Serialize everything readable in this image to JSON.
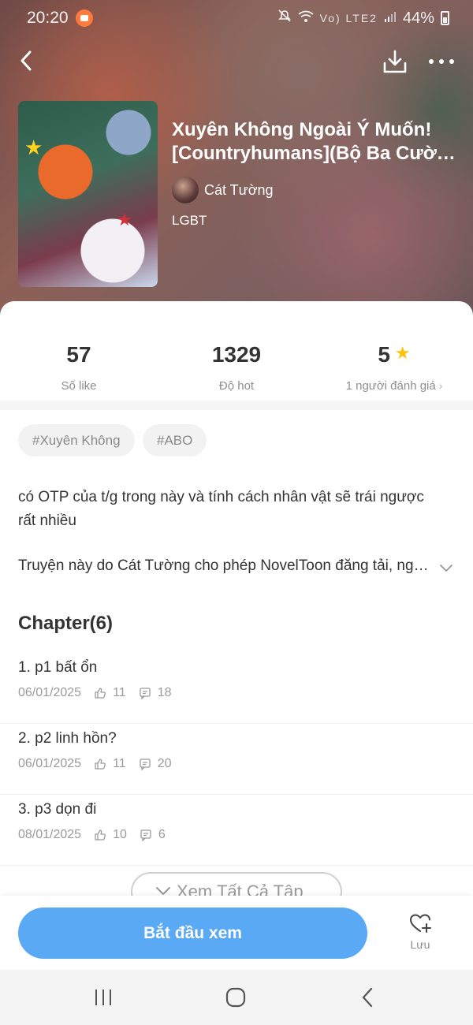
{
  "status_bar": {
    "time": "20:20",
    "network_label": "Vo) LTE2",
    "battery": "44%"
  },
  "book": {
    "title_line1": "Xuyên Không Ngoài Ý Muốn!",
    "title_line2": "[Countryhumans](Bộ Ba Cường Quốc)",
    "author": "Cát Tường",
    "genre": "LGBT"
  },
  "stats": {
    "likes": {
      "value": "57",
      "label": "Số like"
    },
    "hot": {
      "value": "1329",
      "label": "Độ hot"
    },
    "rating": {
      "value": "5",
      "label": "1 người đánh giá"
    }
  },
  "tags": [
    "#Xuyên Không",
    "#ABO"
  ],
  "description": "có OTP của t/g trong này và tính cách nhân vật sẽ trái ngược rất nhiều",
  "copyright": "Truyện này do Cát Tường cho phép NovelToon đăng tải, nghiêm cấm sao chép",
  "chapters": {
    "heading": "Chapter(6)",
    "items": [
      {
        "title": "1. p1 bất ổn",
        "date": "06/01/2025",
        "likes": "11",
        "comments": "18"
      },
      {
        "title": "2. p2 linh hồn?",
        "date": "06/01/2025",
        "likes": "11",
        "comments": "20"
      },
      {
        "title": "3. p3 dọn đi",
        "date": "08/01/2025",
        "likes": "10",
        "comments": "6"
      }
    ],
    "view_all_label": "Xem Tất Cả Tập"
  },
  "actions": {
    "start_label": "Bắt đầu xem",
    "save_label": "Lưu"
  },
  "colors": {
    "primary": "#5aa9f5",
    "star": "#ffc107"
  }
}
